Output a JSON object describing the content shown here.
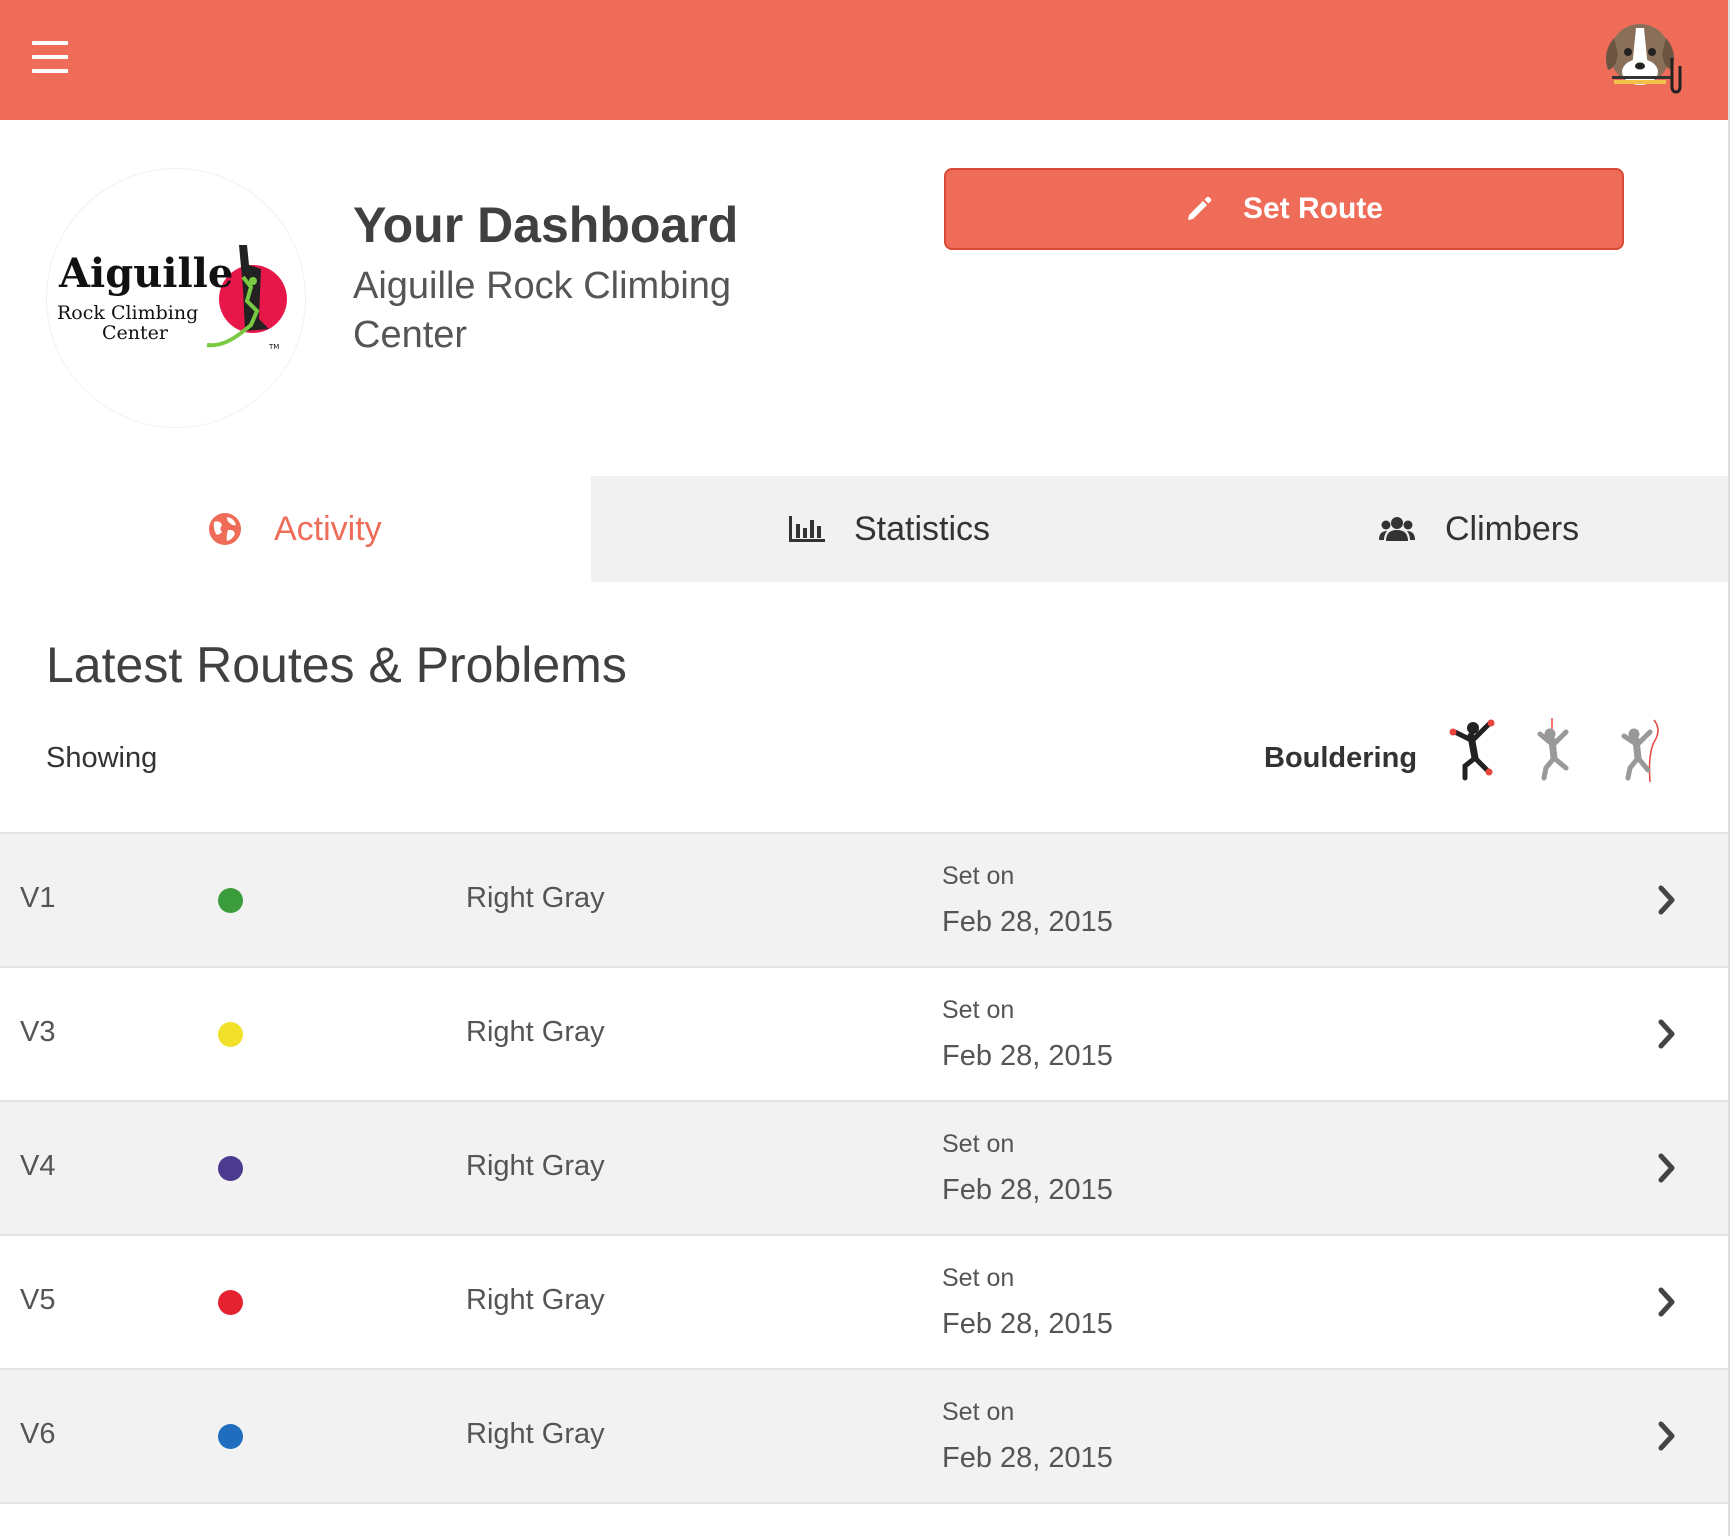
{
  "topbar": {
    "menu_icon": "hamburger-menu-icon",
    "avatar_icon": "dog-avatar-icon",
    "brand_color": "#EF6C58"
  },
  "header": {
    "logo": {
      "name": "Aiguille",
      "line1": "Rock Climbing",
      "line2": "Center",
      "tm": "TM"
    },
    "title": "Your Dashboard",
    "subtitle": "Aiguille Rock Climbing Center",
    "set_route_label": "Set Route",
    "set_route_icon": "pencil-icon"
  },
  "tabs": [
    {
      "label": "Activity",
      "icon": "globe-icon",
      "active": true
    },
    {
      "label": "Statistics",
      "icon": "bar-chart-icon",
      "active": false
    },
    {
      "label": "Climbers",
      "icon": "users-icon",
      "active": false
    }
  ],
  "section": {
    "title": "Latest Routes & Problems",
    "showing_label": "Showing",
    "filter_label": "Bouldering",
    "filters": [
      {
        "icon": "bouldering-climber-icon",
        "active": true
      },
      {
        "icon": "top-rope-climber-icon",
        "active": false
      },
      {
        "icon": "lead-climber-icon",
        "active": false
      }
    ]
  },
  "routes": [
    {
      "grade": "V1",
      "color": "#3a9c3a",
      "wall": "Right Gray",
      "set_label": "Set on",
      "date": "Feb 28, 2015"
    },
    {
      "grade": "V3",
      "color": "#f2e12a",
      "wall": "Right Gray",
      "set_label": "Set on",
      "date": "Feb 28, 2015"
    },
    {
      "grade": "V4",
      "color": "#4b3a8f",
      "wall": "Right Gray",
      "set_label": "Set on",
      "date": "Feb 28, 2015"
    },
    {
      "grade": "V5",
      "color": "#e52230",
      "wall": "Right Gray",
      "set_label": "Set on",
      "date": "Feb 28, 2015"
    },
    {
      "grade": "V6",
      "color": "#1f6dbf",
      "wall": "Right Gray",
      "set_label": "Set on",
      "date": "Feb 28, 2015"
    }
  ]
}
